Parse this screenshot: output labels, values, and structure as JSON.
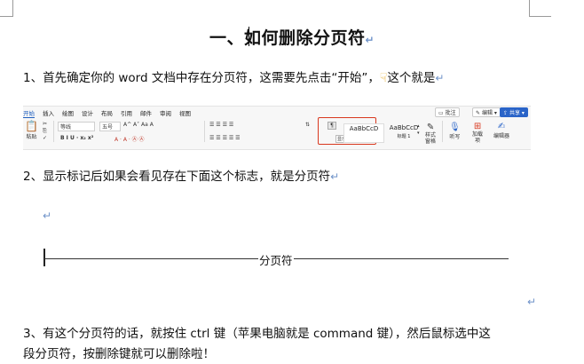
{
  "title": "一、如何删除分页符",
  "para1": "1、首先确定你的 word 文档中存在分页符，这需要先点击“开始”，",
  "para1_tail": "这个就是",
  "ribbon": {
    "tabs": [
      "开始",
      "插入",
      "绘图",
      "设计",
      "布局",
      "引用",
      "邮件",
      "审阅",
      "视图"
    ],
    "paste": "粘贴",
    "font": "等线",
    "size": "五号",
    "font_btns": "A^  A˅  Aa  A",
    "format_btns": "B  I  U  ·  x₂  x²",
    "color_btns": "A  ·  A  ·  Ⓐ  Ⓐ",
    "para_btns": "☰  ☰  ☰  ☰",
    "para_btns2": "☰  ☰  ☰  ☰  ☰",
    "show_marks_tip": "显示/隐藏编辑标记",
    "style1": "AaBbCcD",
    "style1_label": "",
    "style2": "AaBbCcD",
    "style2_label": "标题 1",
    "style_pane": "样式\n窗格",
    "dictate": "听写",
    "addins": "加载\n项",
    "editor": "编辑器",
    "comment_btn": "批注",
    "edit_btn": "编辑",
    "share_btn": "共享"
  },
  "para2": "2、显示标记后如果会看见存在下面这个标志，就是分页符",
  "page_break_label": "分页符",
  "para3_line1": "3、有这个分页符的话，就按住 ctrl 键（苹果电脑就是 command 键），然后鼠标选中这",
  "para3_line2": "段分页符，按删除键就可以删除啦！",
  "return_mark": "↵"
}
